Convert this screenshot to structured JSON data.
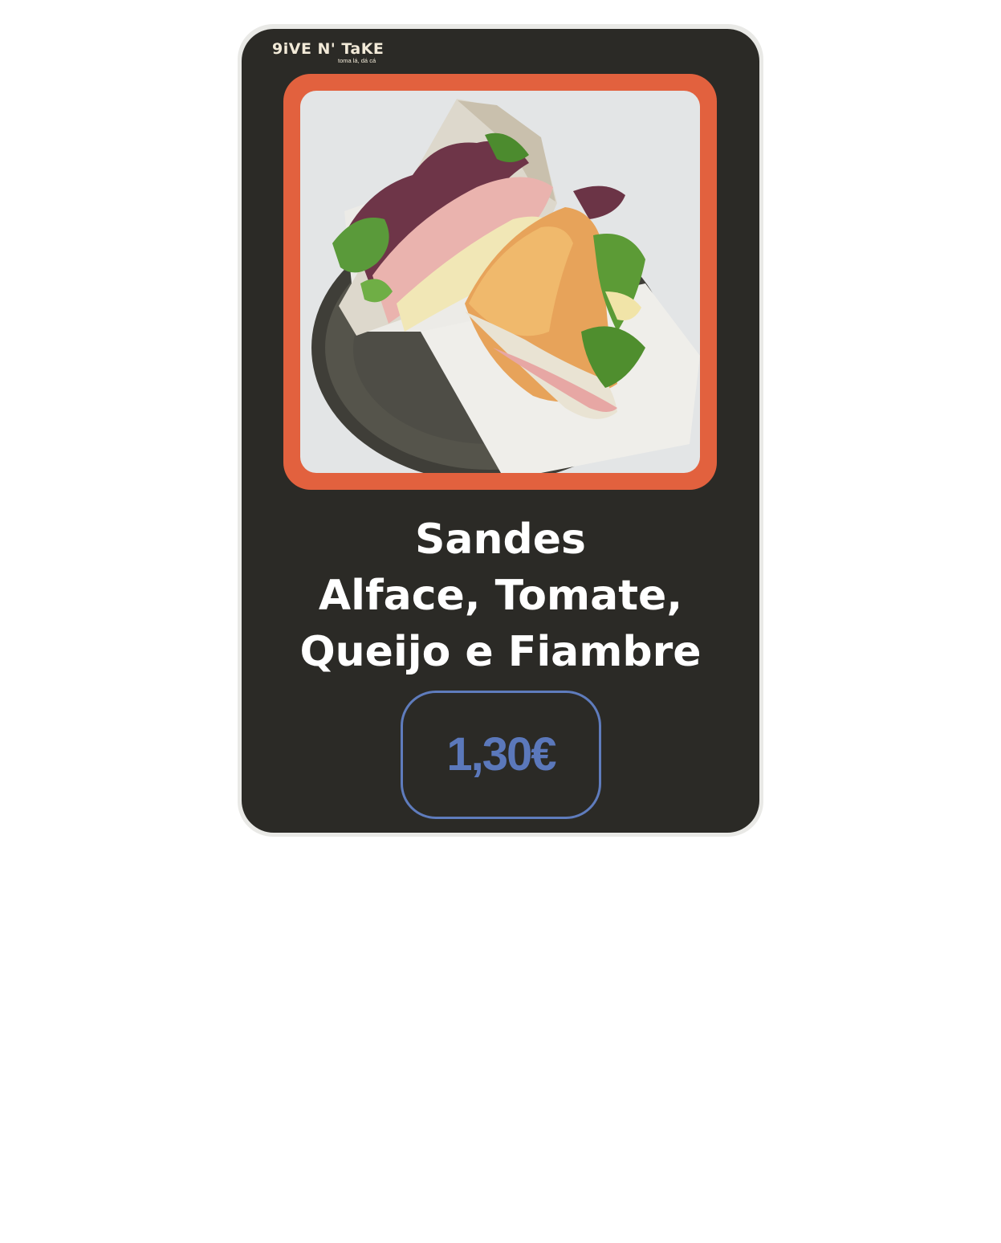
{
  "brand": {
    "name": "9iVE N' TaKE",
    "tagline": "toma lá, dá cá"
  },
  "product": {
    "image_alt": "Sandes de alface, tomate, queijo e fiambre",
    "title_lines": [
      "Sandes",
      "Alface, Tomate,",
      "Queijo e Fiambre"
    ],
    "price": "1,30€"
  },
  "colors": {
    "card_background": "#2b2a26",
    "photo_frame": "#e2613e",
    "price_accent": "#5b78bb",
    "title_text": "#ffffff",
    "logo_text": "#f2ead8"
  }
}
